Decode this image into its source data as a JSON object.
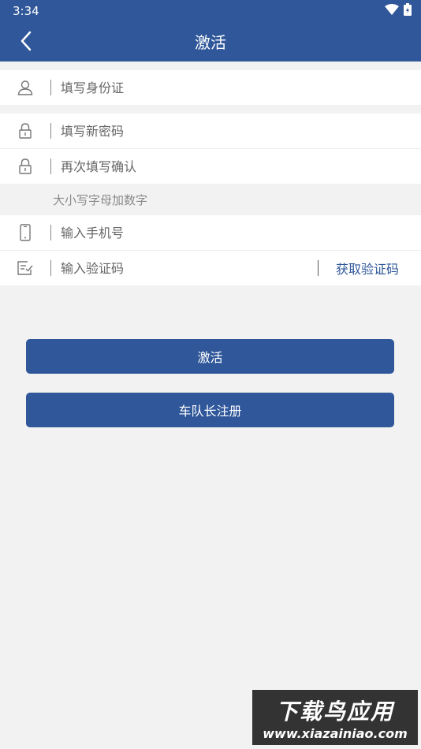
{
  "status_bar": {
    "time": "3:34"
  },
  "header": {
    "title": "激活"
  },
  "form": {
    "id_number": {
      "placeholder": "填写身份证"
    },
    "new_password": {
      "placeholder": "填写新密码"
    },
    "confirm_password": {
      "placeholder": "再次填写确认"
    },
    "password_hint": "大小写字母加数字",
    "phone": {
      "placeholder": "输入手机号"
    },
    "verification_code": {
      "placeholder": "输入验证码",
      "get_code_label": "获取验证码"
    }
  },
  "buttons": {
    "activate_label": "激活",
    "captain_register_label": "车队长注册"
  },
  "watermark": {
    "title": "下载鸟应用",
    "url": "www.xiazainiao.com"
  },
  "colors": {
    "primary": "#2f579a",
    "background": "#f2f2f2"
  },
  "icons": [
    "back-arrow-icon",
    "user-icon",
    "lock-icon",
    "phone-icon",
    "edit-code-icon",
    "wifi-icon",
    "battery-icon"
  ]
}
